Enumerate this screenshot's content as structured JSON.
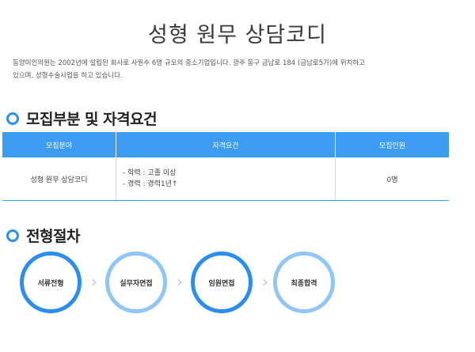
{
  "page": {
    "title": "성형 원무 상담코디",
    "intro_line1": "동양미인의원는 2002년에 설립된 회사로 사원수 6명 규모의 중소기업입니다. 광주 동구 금남로 184 (금남로5가)에 위치하고",
    "intro_line2": "있으며, 성형수술사업을 하고 있습니다."
  },
  "section_requirements": {
    "title": "모집부분 및 자격요건",
    "icon": "ring-icon",
    "table": {
      "headers": [
        "모집분야",
        "자격요건",
        "모집인원"
      ],
      "rows": [
        {
          "field": "성형 원무 상담코디",
          "qualifications": [
            "- 학력 : 고졸 이상",
            "- 경력 : 경력1년↑"
          ],
          "count": "0명"
        }
      ]
    }
  },
  "section_process": {
    "title": "전형절차",
    "icon": "ring-icon",
    "steps": [
      {
        "label": "서류전형"
      },
      {
        "label": "실무자면접"
      },
      {
        "label": "임원면접"
      },
      {
        "label": "최종합격"
      }
    ],
    "arrow_icon": "chevron-right-icon"
  },
  "colors": {
    "accent": "#2d8ff0",
    "header_bg": "#3b9cf2",
    "step_light": "#8fc6f6",
    "arrow": "#d4d4d4"
  }
}
